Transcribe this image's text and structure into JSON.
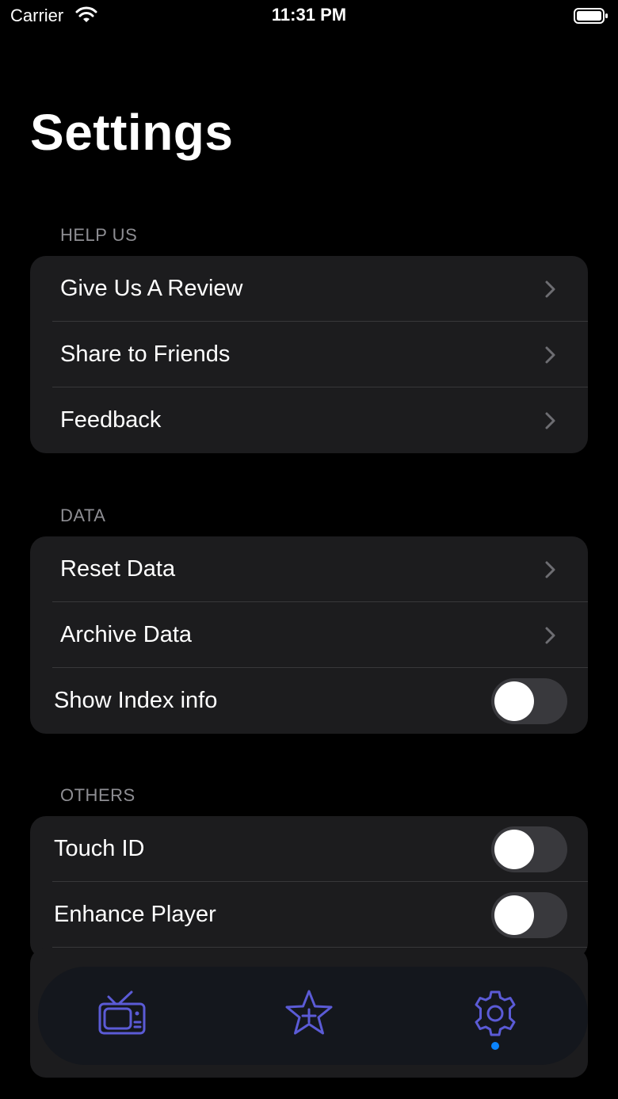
{
  "status_bar": {
    "carrier": "Carrier",
    "time": "11:31 PM"
  },
  "page": {
    "title": "Settings"
  },
  "sections": {
    "help_us": {
      "header": "HELP US",
      "items": [
        "Give Us A Review",
        "Share to Friends",
        "Feedback"
      ]
    },
    "data": {
      "header": "DATA",
      "items": [
        "Reset Data",
        "Archive Data"
      ],
      "toggle_label": "Show Index info",
      "toggle_on": false
    },
    "others": {
      "header": "OTHERS",
      "toggles": [
        {
          "label": "Touch ID",
          "on": false
        },
        {
          "label": "Enhance Player",
          "on": false
        }
      ]
    }
  },
  "tab_bar": {
    "tabs": [
      {
        "icon": "tv-icon",
        "selected": false
      },
      {
        "icon": "star-plus-icon",
        "selected": false
      },
      {
        "icon": "gear-icon",
        "selected": true
      }
    ]
  },
  "colors": {
    "background": "#000000",
    "cell_background": "#1c1c1e",
    "section_header": "#8e8e93",
    "tab_icon": "#5b5bd6",
    "selected_dot": "#0a84ff",
    "toggle_off_track": "#39393d"
  }
}
